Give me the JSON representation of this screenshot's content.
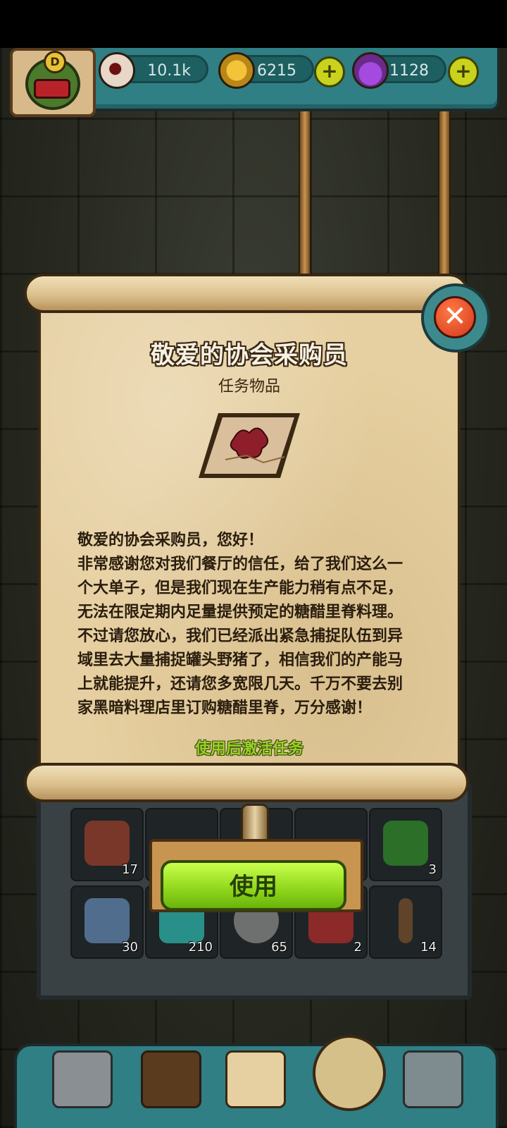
{
  "resources": {
    "eyes": {
      "value": "10.1k",
      "icon": "eyeball-icon"
    },
    "coins": {
      "value": "6215",
      "icon": "coin-icon"
    },
    "potions": {
      "value": "1128",
      "icon": "potion-icon"
    }
  },
  "player": {
    "rank_letter": "D"
  },
  "dialog": {
    "title": "敬爱的协会采购员",
    "subtitle": "任务物品",
    "item_icon": "map-scroll-icon",
    "body_lines": [
      "敬爱的协会采购员，您好！",
      "非常感谢您对我们餐厅的信任，给了我们这么一",
      "个大单子，但是我们现在生产能力稍有点不足，",
      "无法在限定期内足量提供预定的糖醋里脊料理。",
      "不过请您放心，我们已经派出紧急捕捉队伍到异",
      "域里去大量捕捉罐头野猪了，相信我们的产能马",
      "上就能提升，还请您多宽限几天。千万不要去别",
      "家黑暗料理店里订购糖醋里脊，万分感谢！"
    ],
    "activate_hint": "使用后激活任务",
    "use_label": "使用",
    "close_symbol": "✕"
  },
  "inventory": {
    "slots": [
      {
        "count": "17",
        "icon": "scroll-icon"
      },
      {
        "count": "",
        "icon": "unknown-icon"
      },
      {
        "count": "",
        "icon": "unknown-icon"
      },
      {
        "count": "",
        "icon": "unknown-icon"
      },
      {
        "count": "3",
        "icon": "green-gem-icon"
      },
      {
        "count": "30",
        "icon": "map-icon"
      },
      {
        "count": "210",
        "icon": "slime-icon"
      },
      {
        "count": "65",
        "icon": "ghost-icon"
      },
      {
        "count": "2",
        "icon": "jar-icon"
      },
      {
        "count": "14",
        "icon": "worm-icon"
      }
    ]
  },
  "colors": {
    "accent_green": "#9bd126",
    "panel_teal": "#2f7f84",
    "parchment": "#e6cfa0"
  }
}
